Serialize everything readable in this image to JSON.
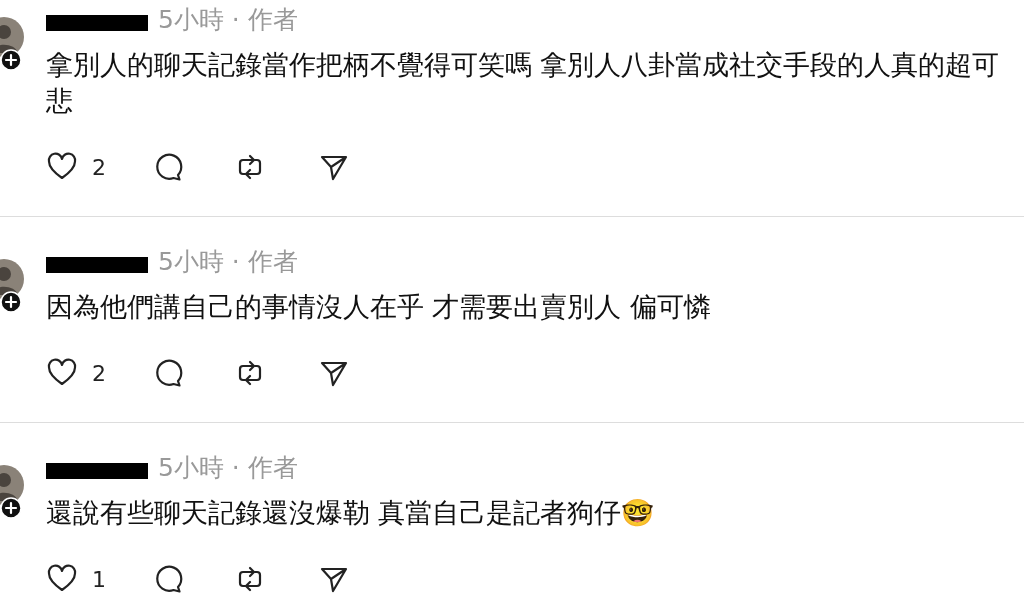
{
  "posts": [
    {
      "meta": "5小時 · 作者",
      "text": "拿別人的聊天記錄當作把柄不覺得可笑嗎 拿別人八卦當成社交手段的人真的超可悲",
      "likes": "2"
    },
    {
      "meta": "5小時 · 作者",
      "text": "因為他們講自己的事情沒人在乎 才需要出賣別人 偏可憐",
      "likes": "2"
    },
    {
      "meta": "5小時 · 作者",
      "text": "還說有些聊天記錄還沒爆勒 真當自己是記者狗仔🤓",
      "likes": "1"
    }
  ]
}
